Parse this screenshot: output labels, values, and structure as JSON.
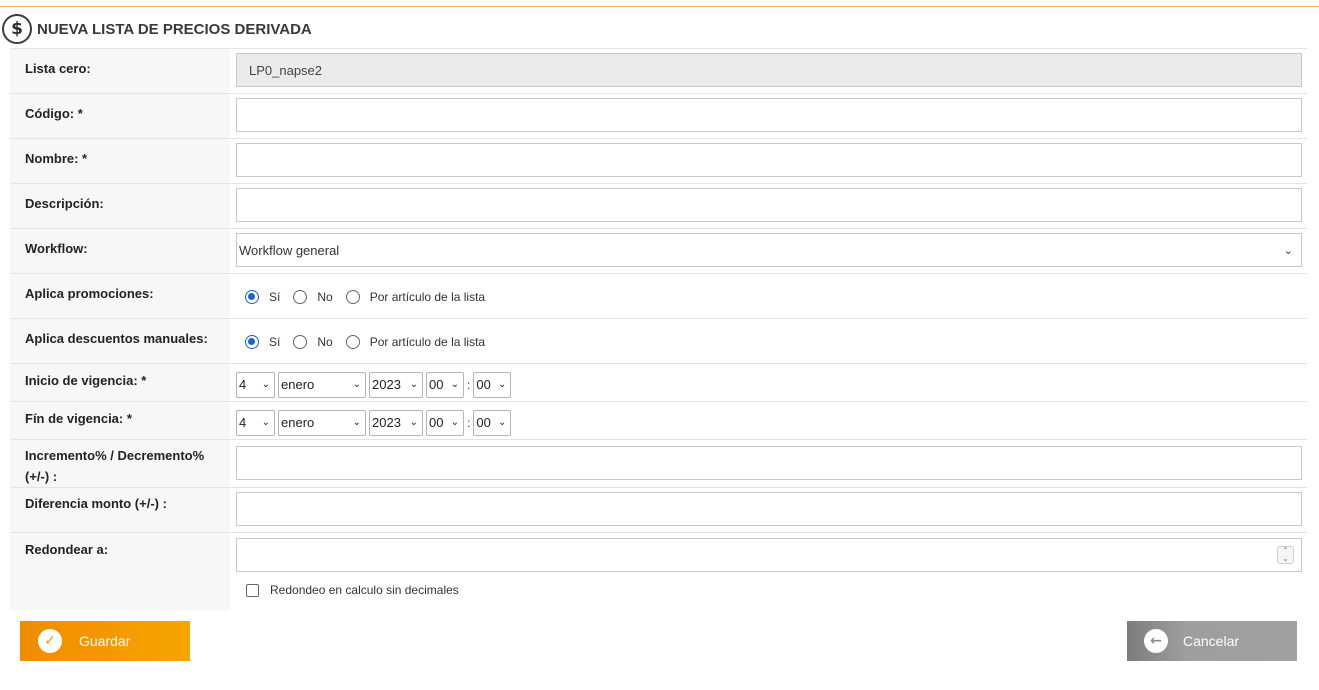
{
  "header": {
    "title": "NUEVA LISTA DE PRECIOS DERIVADA",
    "icon": "dollar-icon",
    "icon_glyph": "$"
  },
  "form": {
    "lista_cero": {
      "label": "Lista cero:",
      "value": "LP0_napse2"
    },
    "codigo": {
      "label": "Código: *",
      "value": ""
    },
    "nombre": {
      "label": "Nombre: *",
      "value": ""
    },
    "descripcion": {
      "label": "Descripción:",
      "value": ""
    },
    "workflow": {
      "label": "Workflow:",
      "value": "Workflow general"
    },
    "aplica_promociones": {
      "label": "Aplica promociones:",
      "options": [
        "Sí",
        "No",
        "Por artículo de la lista"
      ],
      "selected": "Sí"
    },
    "aplica_descuentos": {
      "label": "Aplica descuentos manuales:",
      "options": [
        "Sí",
        "No",
        "Por artículo de la lista"
      ],
      "selected": "Sí"
    },
    "inicio_vigencia": {
      "label": "Inicio de vigencia: *",
      "day": "4",
      "month": "enero",
      "year": "2023",
      "hour": "00",
      "minute": "00"
    },
    "fin_vigencia": {
      "label": "Fín de vigencia: *",
      "day": "4",
      "month": "enero",
      "year": "2023",
      "hour": "00",
      "minute": "00"
    },
    "incremento": {
      "label": "Incremento% / Decremento% (+/-) :",
      "value": ""
    },
    "diferencia_monto": {
      "label": "Diferencia monto (+/-) :",
      "value": ""
    },
    "redondear": {
      "label": "Redondear a:",
      "value": "",
      "checkbox_label": "Redondeo en calculo sin decimales",
      "checkbox_checked": false
    }
  },
  "buttons": {
    "save": "Guardar",
    "cancel": "Cancelar"
  },
  "colors": {
    "accent": "#f29300",
    "radio": "#1a66d0",
    "cancel": "#9e9e9e"
  }
}
